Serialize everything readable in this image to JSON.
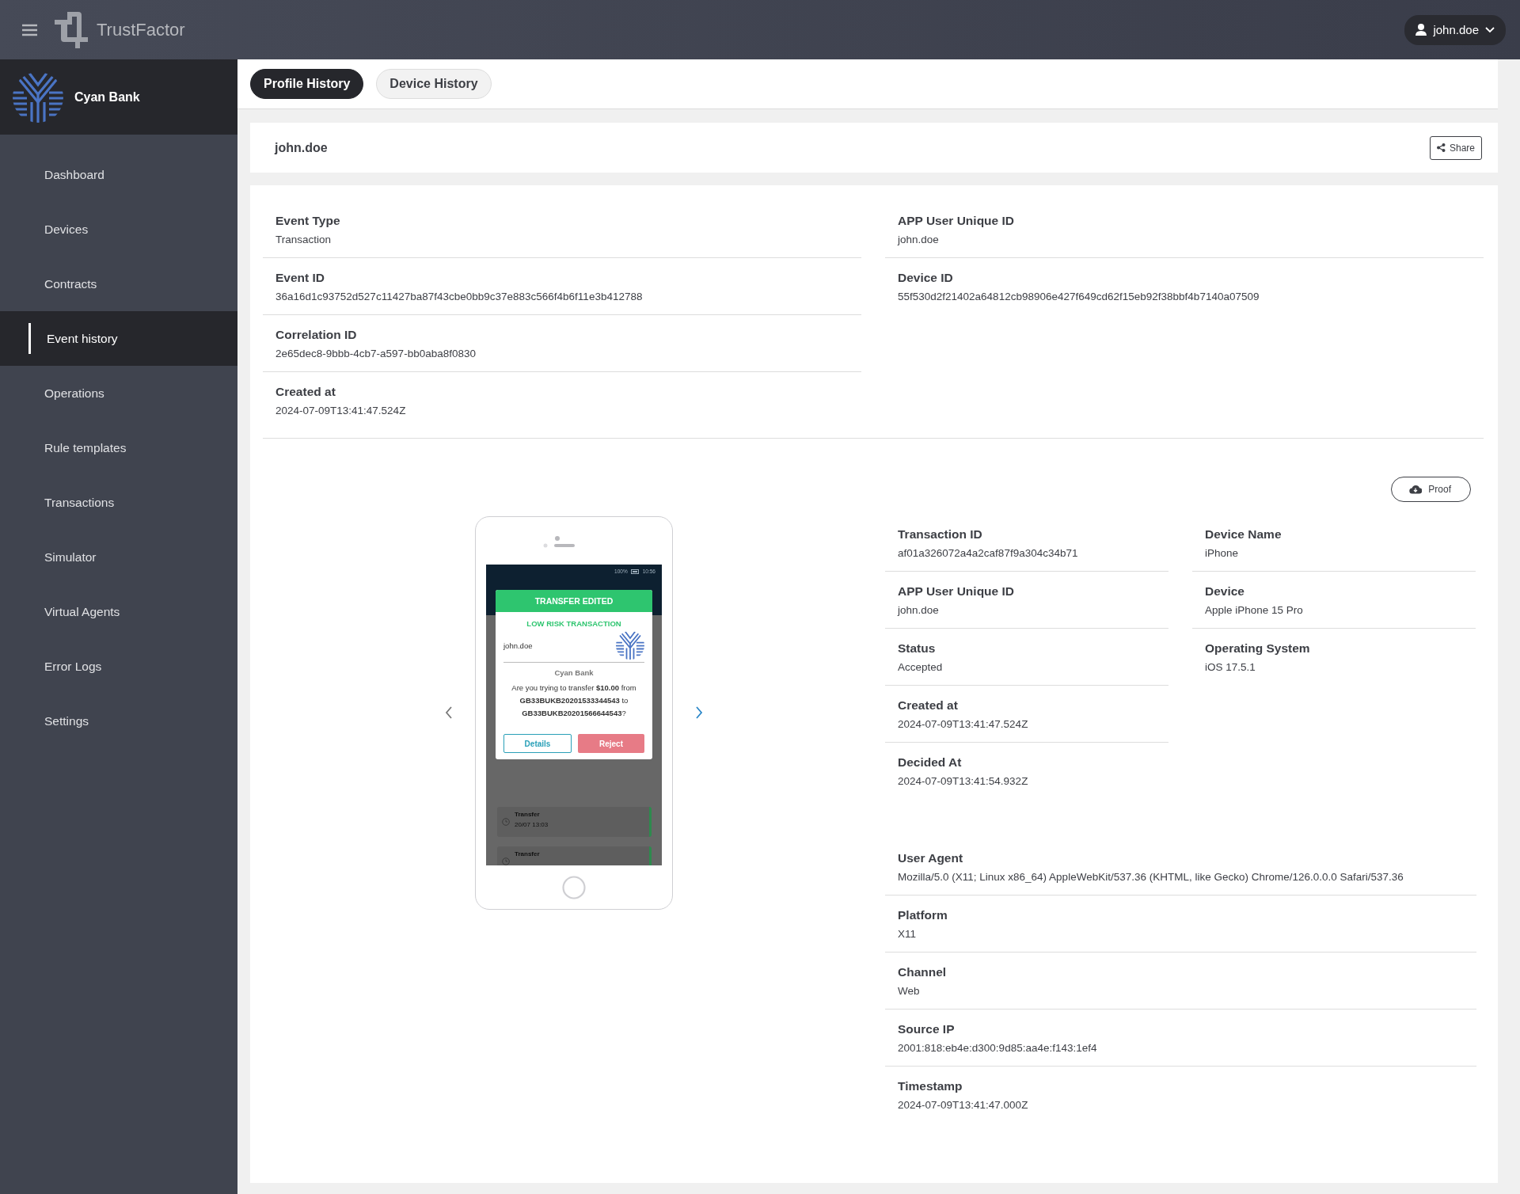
{
  "topbar": {
    "app_name": "TrustFactor",
    "user": "john.doe"
  },
  "sidebar": {
    "org_name": "Cyan Bank",
    "items": [
      {
        "label": "Dashboard",
        "selected": false
      },
      {
        "label": "Devices",
        "selected": false
      },
      {
        "label": "Contracts",
        "selected": false
      },
      {
        "label": "Event history",
        "selected": true
      },
      {
        "label": "Operations",
        "selected": false
      },
      {
        "label": "Rule templates",
        "selected": false
      },
      {
        "label": "Transactions",
        "selected": false
      },
      {
        "label": "Simulator",
        "selected": false
      },
      {
        "label": "Virtual Agents",
        "selected": false
      },
      {
        "label": "Error Logs",
        "selected": false
      },
      {
        "label": "Settings",
        "selected": false
      }
    ]
  },
  "tabs": [
    {
      "label": "Profile History",
      "selected": true
    },
    {
      "label": "Device History",
      "selected": false
    }
  ],
  "profile": {
    "username": "john.doe",
    "share_button": "Share"
  },
  "event_details": {
    "left": [
      {
        "label": "Event Type",
        "value": "Transaction"
      },
      {
        "label": "Event ID",
        "value": "36a16d1c93752d527c11427ba87f43cbe0bb9c37e883c566f4b6f11e3b412788"
      },
      {
        "label": "Correlation ID",
        "value": "2e65dec8-9bbb-4cb7-a597-bb0aba8f0830"
      },
      {
        "label": "Created at",
        "value": "2024-07-09T13:41:47.524Z"
      }
    ],
    "right": [
      {
        "label": "APP User Unique ID",
        "value": "john.doe"
      },
      {
        "label": "Device ID",
        "value": "55f530d2f21402a64812cb98906e427f649cd62f15eb92f38bbf4b7140a07509"
      }
    ]
  },
  "transaction": {
    "proof_button": "Proof",
    "phone_preview": {
      "battery": "100%",
      "time": "10:56",
      "banner": "TRANSFER EDITED",
      "risk": "LOW RISK TRANSACTION",
      "user": "john.doe",
      "bank": "Cyan Bank",
      "message": "Are you trying to transfer **$10.00** from **GB33BUKB20201533344543** to **GB33BUKB20201566644543**?",
      "details_button": "Details",
      "reject_button": "Reject",
      "list": [
        {
          "title": "Transfer",
          "time": "20/07 13:03"
        },
        {
          "title": "Transfer"
        }
      ]
    },
    "details_left": [
      {
        "label": "Transaction ID",
        "value": "af01a326072a4a2caf87f9a304c34b71"
      },
      {
        "label": "APP User Unique ID",
        "value": "john.doe"
      },
      {
        "label": "Status",
        "value": "Accepted"
      },
      {
        "label": "Created at",
        "value": "2024-07-09T13:41:47.524Z"
      },
      {
        "label": "Decided At",
        "value": "2024-07-09T13:41:54.932Z"
      }
    ],
    "details_right": [
      {
        "label": "Device Name",
        "value": "iPhone"
      },
      {
        "label": "Device",
        "value": "Apple iPhone 15 Pro"
      },
      {
        "label": "Operating System",
        "value": "iOS 17.5.1"
      }
    ],
    "details_full": [
      {
        "label": "User Agent",
        "value": "Mozilla/5.0 (X11; Linux x86_64) AppleWebKit/537.36 (KHTML, like Gecko) Chrome/126.0.0.0 Safari/537.36"
      },
      {
        "label": "Platform",
        "value": "X11"
      },
      {
        "label": "Channel",
        "value": "Web"
      },
      {
        "label": "Source IP",
        "value": "2001:818:eb4e:d300:9d85:aa4e:f143:1ef4"
      },
      {
        "label": "Timestamp",
        "value": "2024-07-09T13:41:47.000Z"
      }
    ]
  }
}
